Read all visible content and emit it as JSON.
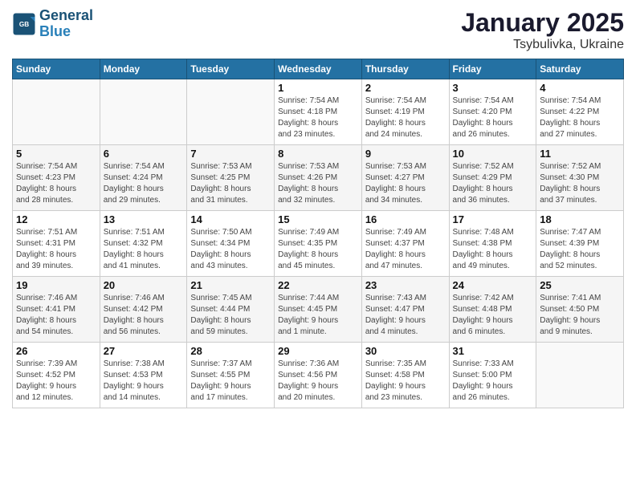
{
  "header": {
    "logo_line1": "General",
    "logo_line2": "Blue",
    "month": "January 2025",
    "location": "Tsybulivka, Ukraine"
  },
  "weekdays": [
    "Sunday",
    "Monday",
    "Tuesday",
    "Wednesday",
    "Thursday",
    "Friday",
    "Saturday"
  ],
  "weeks": [
    [
      {
        "day": "",
        "info": ""
      },
      {
        "day": "",
        "info": ""
      },
      {
        "day": "",
        "info": ""
      },
      {
        "day": "1",
        "info": "Sunrise: 7:54 AM\nSunset: 4:18 PM\nDaylight: 8 hours\nand 23 minutes."
      },
      {
        "day": "2",
        "info": "Sunrise: 7:54 AM\nSunset: 4:19 PM\nDaylight: 8 hours\nand 24 minutes."
      },
      {
        "day": "3",
        "info": "Sunrise: 7:54 AM\nSunset: 4:20 PM\nDaylight: 8 hours\nand 26 minutes."
      },
      {
        "day": "4",
        "info": "Sunrise: 7:54 AM\nSunset: 4:22 PM\nDaylight: 8 hours\nand 27 minutes."
      }
    ],
    [
      {
        "day": "5",
        "info": "Sunrise: 7:54 AM\nSunset: 4:23 PM\nDaylight: 8 hours\nand 28 minutes."
      },
      {
        "day": "6",
        "info": "Sunrise: 7:54 AM\nSunset: 4:24 PM\nDaylight: 8 hours\nand 29 minutes."
      },
      {
        "day": "7",
        "info": "Sunrise: 7:53 AM\nSunset: 4:25 PM\nDaylight: 8 hours\nand 31 minutes."
      },
      {
        "day": "8",
        "info": "Sunrise: 7:53 AM\nSunset: 4:26 PM\nDaylight: 8 hours\nand 32 minutes."
      },
      {
        "day": "9",
        "info": "Sunrise: 7:53 AM\nSunset: 4:27 PM\nDaylight: 8 hours\nand 34 minutes."
      },
      {
        "day": "10",
        "info": "Sunrise: 7:52 AM\nSunset: 4:29 PM\nDaylight: 8 hours\nand 36 minutes."
      },
      {
        "day": "11",
        "info": "Sunrise: 7:52 AM\nSunset: 4:30 PM\nDaylight: 8 hours\nand 37 minutes."
      }
    ],
    [
      {
        "day": "12",
        "info": "Sunrise: 7:51 AM\nSunset: 4:31 PM\nDaylight: 8 hours\nand 39 minutes."
      },
      {
        "day": "13",
        "info": "Sunrise: 7:51 AM\nSunset: 4:32 PM\nDaylight: 8 hours\nand 41 minutes."
      },
      {
        "day": "14",
        "info": "Sunrise: 7:50 AM\nSunset: 4:34 PM\nDaylight: 8 hours\nand 43 minutes."
      },
      {
        "day": "15",
        "info": "Sunrise: 7:49 AM\nSunset: 4:35 PM\nDaylight: 8 hours\nand 45 minutes."
      },
      {
        "day": "16",
        "info": "Sunrise: 7:49 AM\nSunset: 4:37 PM\nDaylight: 8 hours\nand 47 minutes."
      },
      {
        "day": "17",
        "info": "Sunrise: 7:48 AM\nSunset: 4:38 PM\nDaylight: 8 hours\nand 49 minutes."
      },
      {
        "day": "18",
        "info": "Sunrise: 7:47 AM\nSunset: 4:39 PM\nDaylight: 8 hours\nand 52 minutes."
      }
    ],
    [
      {
        "day": "19",
        "info": "Sunrise: 7:46 AM\nSunset: 4:41 PM\nDaylight: 8 hours\nand 54 minutes."
      },
      {
        "day": "20",
        "info": "Sunrise: 7:46 AM\nSunset: 4:42 PM\nDaylight: 8 hours\nand 56 minutes."
      },
      {
        "day": "21",
        "info": "Sunrise: 7:45 AM\nSunset: 4:44 PM\nDaylight: 8 hours\nand 59 minutes."
      },
      {
        "day": "22",
        "info": "Sunrise: 7:44 AM\nSunset: 4:45 PM\nDaylight: 9 hours\nand 1 minute."
      },
      {
        "day": "23",
        "info": "Sunrise: 7:43 AM\nSunset: 4:47 PM\nDaylight: 9 hours\nand 4 minutes."
      },
      {
        "day": "24",
        "info": "Sunrise: 7:42 AM\nSunset: 4:48 PM\nDaylight: 9 hours\nand 6 minutes."
      },
      {
        "day": "25",
        "info": "Sunrise: 7:41 AM\nSunset: 4:50 PM\nDaylight: 9 hours\nand 9 minutes."
      }
    ],
    [
      {
        "day": "26",
        "info": "Sunrise: 7:39 AM\nSunset: 4:52 PM\nDaylight: 9 hours\nand 12 minutes."
      },
      {
        "day": "27",
        "info": "Sunrise: 7:38 AM\nSunset: 4:53 PM\nDaylight: 9 hours\nand 14 minutes."
      },
      {
        "day": "28",
        "info": "Sunrise: 7:37 AM\nSunset: 4:55 PM\nDaylight: 9 hours\nand 17 minutes."
      },
      {
        "day": "29",
        "info": "Sunrise: 7:36 AM\nSunset: 4:56 PM\nDaylight: 9 hours\nand 20 minutes."
      },
      {
        "day": "30",
        "info": "Sunrise: 7:35 AM\nSunset: 4:58 PM\nDaylight: 9 hours\nand 23 minutes."
      },
      {
        "day": "31",
        "info": "Sunrise: 7:33 AM\nSunset: 5:00 PM\nDaylight: 9 hours\nand 26 minutes."
      },
      {
        "day": "",
        "info": ""
      }
    ]
  ]
}
